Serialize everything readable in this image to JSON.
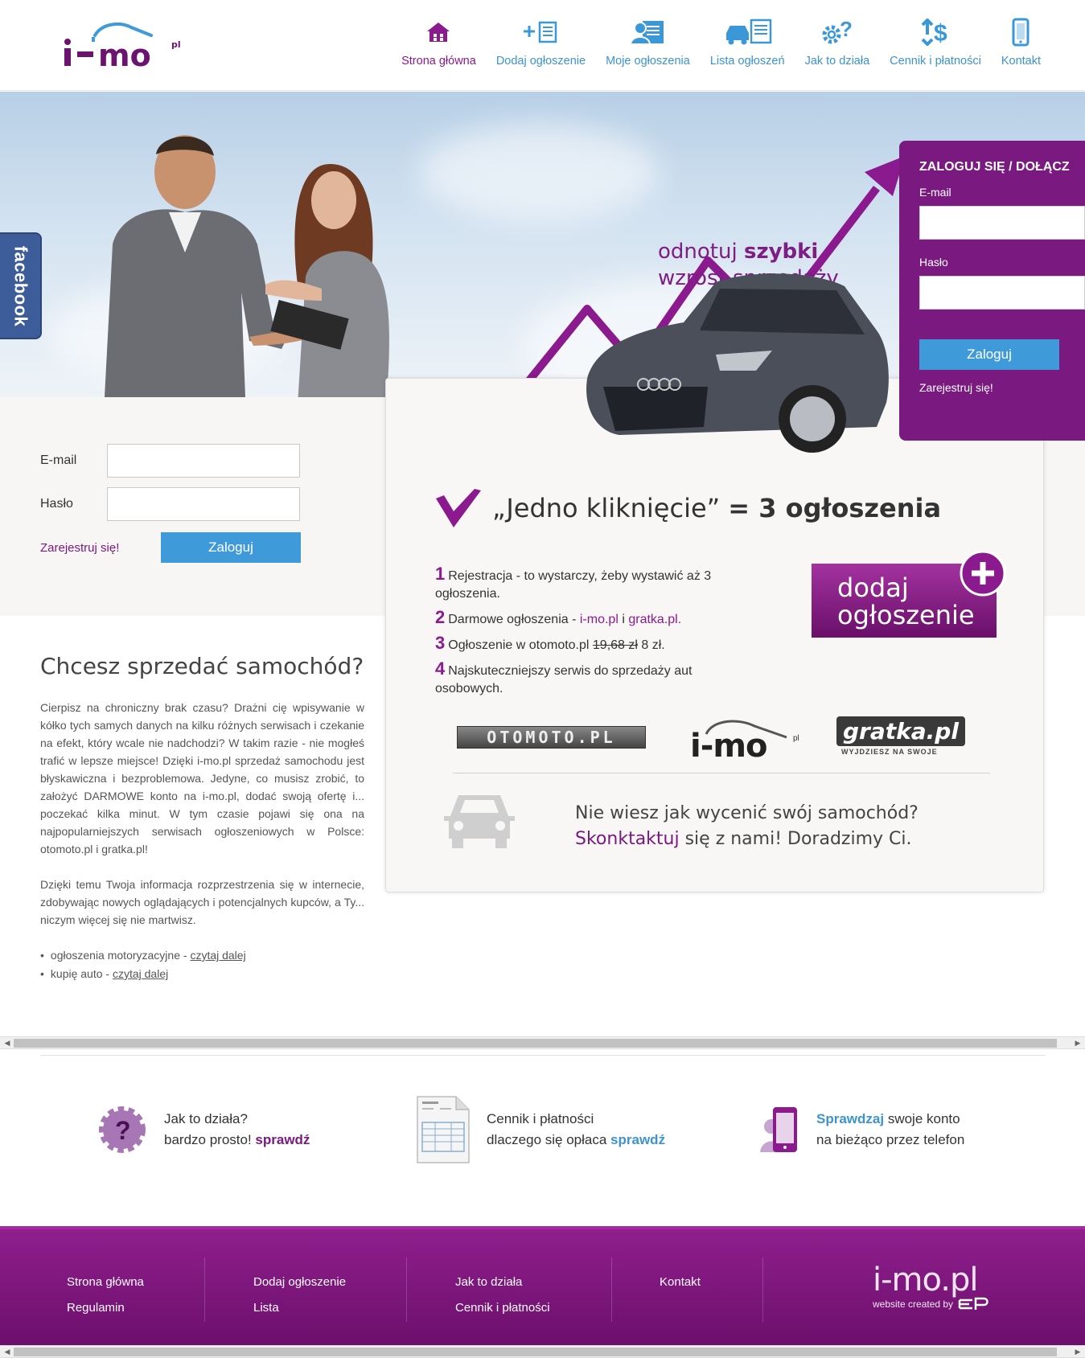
{
  "header": {
    "nav": [
      {
        "label": "Strona główna",
        "icon": "home-icon",
        "active": true
      },
      {
        "label": "Dodaj ogłoszenie",
        "icon": "add-listing-icon"
      },
      {
        "label": "Moje ogłoszenia",
        "icon": "my-listings-icon"
      },
      {
        "label": "Lista ogłoszeń",
        "icon": "car-list-icon"
      },
      {
        "label": "Jak to działa",
        "icon": "help-gear-icon"
      },
      {
        "label": "Cennik i płatności",
        "icon": "pricing-icon"
      },
      {
        "label": "Kontakt",
        "icon": "phone-icon"
      }
    ]
  },
  "hero": {
    "facebook_tab": "facebook",
    "tagline_line1_a": "odnotuj ",
    "tagline_line1_b": "szybki",
    "tagline_line2": "wzrost sprzedaży"
  },
  "login_panel": {
    "title": "ZALOGUJ SIĘ / DOŁĄCZ",
    "email_label": "E-mail",
    "password_label": "Hasło",
    "login_button": "Zaloguj",
    "register_link": "Zarejestruj się!"
  },
  "left_login": {
    "email_label": "E-mail",
    "password_label": "Hasło",
    "register_link": "Zarejestruj się!",
    "login_button": "Zaloguj"
  },
  "card": {
    "heading_a": "„Jedno kliknięcie”",
    "heading_b": "= 3 ogłoszenia",
    "steps": [
      {
        "num": "1",
        "text": "Rejestracja - to wystarczy, żeby wystawić aż 3 ogłoszenia."
      },
      {
        "num": "2",
        "text_a": "Darmowe ogłoszenia - ",
        "link_a": "i-mo.pl",
        "text_b": " i ",
        "link_b": "gratka.pl."
      },
      {
        "num": "3",
        "text_a": "Ogłoszenie w otomoto.pl ",
        "old_price": "19,68 zł",
        "text_b": " 8 zł."
      },
      {
        "num": "4",
        "text": "Najskuteczniejszy serwis do sprzedaży aut osobowych."
      }
    ],
    "add_button_line1": "dodaj",
    "add_button_line2": "ogłoszenie",
    "brand_otomoto": "OTOMOTO.PL",
    "brand_imo": "i-mo",
    "brand_imo_sup": "pl",
    "brand_gratka": "gratka.pl",
    "brand_gratka_sub": "WYJDZIESZ NA SWOJE",
    "ask_line1": "Nie wiesz jak wycenić swój samochód?",
    "ask_link": "Skonktaktuj",
    "ask_line2": " się z nami! Doradzimy Ci."
  },
  "left_text": {
    "heading": "Chcesz sprzedać samochód?",
    "p1": "Cierpisz na chroniczny brak czasu? Drażni cię wpisywanie w kółko tych samych danych na kilku różnych serwisach i czekanie na efekt, który wcale nie nadchodzi? W takim razie - nie mogłeś trafić w lepsze miejsce! Dzięki i-mo.pl sprzedaż samochodu jest błyskawiczna i bezproblemowa. Jedyne, co musisz zrobić, to założyć DARMOWE konto na i-mo.pl, dodać swoją ofertę i... poczekać kilka minut. W tym czasie pojawi się ona na najpopularniejszych serwisach ogłoszeniowych w Polsce: otomoto.pl i gratka.pl!",
    "p2": "Dzięki temu Twoja informacja rozprzestrzenia się w internecie, zdobywając nowych oglądających i potencjalnych kupców, a Ty... niczym więcej się nie martwisz.",
    "list": [
      {
        "text": "ogłoszenia motoryzacyjne - ",
        "link": "czytaj dalej"
      },
      {
        "text": "kupię auto - ",
        "link": "czytaj dalej"
      }
    ]
  },
  "features": [
    {
      "line1": "Jak to działa?",
      "line2_a": "bardzo prosto! ",
      "line2_link": "sprawdź"
    },
    {
      "line1": "Cennik i płatności",
      "line2_a": "dlaczego się opłaca ",
      "line2_link": "sprawdź"
    },
    {
      "line1_link": "Sprawdzaj",
      "line1_b": " swoje konto",
      "line2_a": "na bieżąco przez telefon"
    }
  ],
  "footer": {
    "col1": [
      "Strona główna",
      "Regulamin"
    ],
    "col2": [
      "Dodaj ogłoszenie",
      "Lista"
    ],
    "col3": [
      "Jak to działa",
      "Cennik i płatności"
    ],
    "col4": [
      "Kontakt"
    ],
    "logo": "i-mo.pl",
    "credit": "website created by"
  },
  "colors": {
    "brand_purple": "#7a1a80",
    "accent_blue": "#3f9ad9"
  }
}
